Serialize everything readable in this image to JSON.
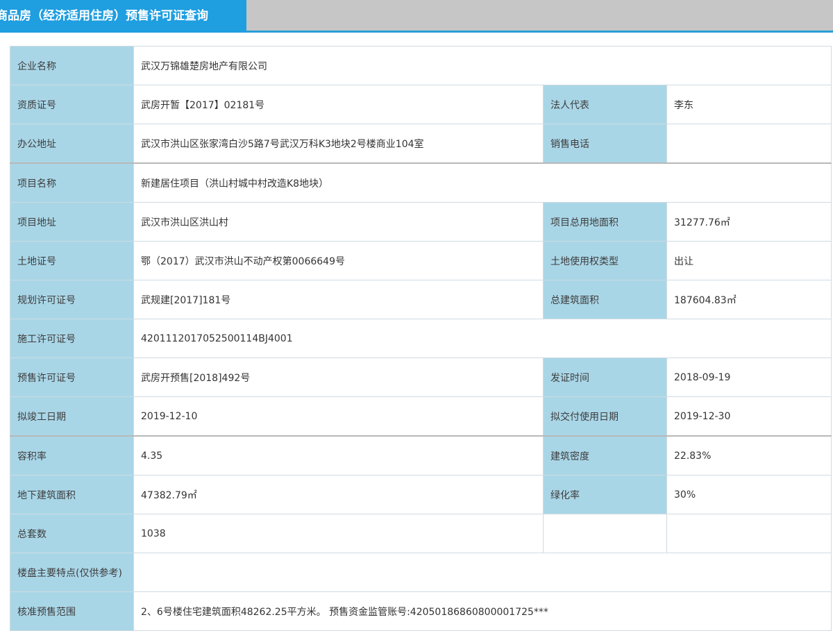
{
  "tabs": {
    "active_label": "商品房（经济适用住房）预售许可证查询"
  },
  "rows": [
    {
      "l1": "企业名称",
      "v1": "武汉万锦雄楚房地产有限公司"
    },
    {
      "l1": "资质证号",
      "v1": "武房开暂【2017】02181号",
      "l2": "法人代表",
      "v2": "李东"
    },
    {
      "l1": "办公地址",
      "v1": "武汉市洪山区张家湾白沙5路7号武汉万科K3地块2号楼商业104室",
      "l2": "销售电话",
      "v2": ""
    },
    {
      "l1": "项目名称",
      "v1": "新建居住项目（洪山村城中村改造K8地块）"
    },
    {
      "l1": "项目地址",
      "v1": "武汉市洪山区洪山村",
      "l2": "项目总用地面积",
      "v2": "31277.76㎡"
    },
    {
      "l1": "土地证号",
      "v1": "鄂（2017）武汉市洪山不动产权第0066649号",
      "l2": "土地使用权类型",
      "v2": "出让"
    },
    {
      "l1": "规划许可证号",
      "v1": "武规建[2017]181号",
      "l2": "总建筑面积",
      "v2": "187604.83㎡"
    },
    {
      "l1": "施工许可证号",
      "v1": "4201112017052500114BJ4001"
    },
    {
      "l1": "预售许可证号",
      "v1": "武房开预售[2018]492号",
      "l2": "发证时间",
      "v2": "2018-09-19"
    },
    {
      "l1": "拟竣工日期",
      "v1": "2019-12-10",
      "l2": "拟交付使用日期",
      "v2": "2019-12-30"
    },
    {
      "l1": "容积率",
      "v1": "4.35",
      "l2": "建筑密度",
      "v2": "22.83%"
    },
    {
      "l1": "地下建筑面积",
      "v1": "47382.79㎡",
      "l2": "绿化率",
      "v2": "30%"
    },
    {
      "l1": "总套数",
      "v1": "1038",
      "l2": "",
      "v2": ""
    },
    {
      "l1": "楼盘主要特点(仅供参考)",
      "v1": ""
    },
    {
      "l1": "核准预售范围",
      "v1": "2、6号楼住宅建筑面积48262.25平方米。 预售资金监管账号:42050186860800001725***"
    }
  ],
  "colors": {
    "tab_active": "#1f9ee0",
    "tab_inactive": "#c6c6c6",
    "label_cell": "#a9d6e7"
  }
}
